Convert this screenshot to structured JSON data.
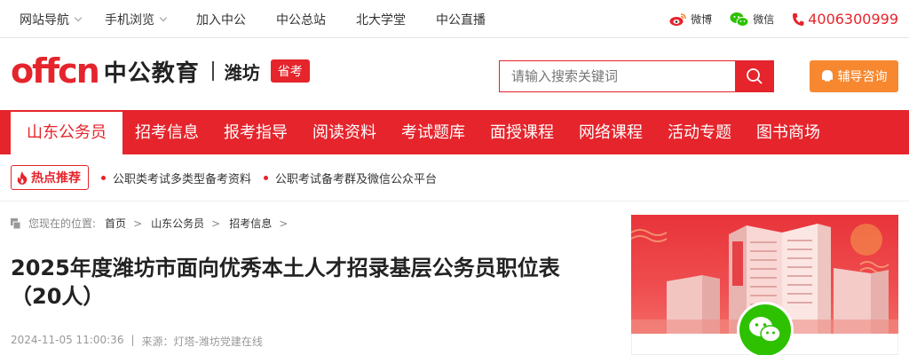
{
  "topbar": {
    "nav": [
      {
        "label": "网站导航",
        "dropdown": true
      },
      {
        "label": "手机浏览",
        "dropdown": true
      },
      {
        "label": "加入中公",
        "dropdown": false
      },
      {
        "label": "中公总站",
        "dropdown": false
      },
      {
        "label": "北大学堂",
        "dropdown": false
      },
      {
        "label": "中公直播",
        "dropdown": false
      }
    ],
    "weibo": "微博",
    "weixin": "微信",
    "phone": "4006300999"
  },
  "header": {
    "logo_latin": "offcn",
    "logo_cn": "中公教育",
    "city": "潍坊",
    "badge": "省考",
    "search_placeholder": "请输入搜索关键词",
    "consult_label": "辅导咨询"
  },
  "mainnav": {
    "items": [
      "山东公务员",
      "招考信息",
      "报考指导",
      "阅读资料",
      "考试题库",
      "面授课程",
      "网络课程",
      "活动专题",
      "图书商场"
    ],
    "active_index": 0
  },
  "hot": {
    "tag": "热点推荐",
    "links": [
      "公职类考试多类型备考资料",
      "公职考试备考群及微信公众平台"
    ]
  },
  "breadcrumb": {
    "prefix": "您现在的位置:",
    "items": [
      "首页",
      "山东公务员",
      "招考信息"
    ],
    "separator": ">"
  },
  "article": {
    "title": "2025年度潍坊市面向优秀本土人才招录基层公务员职位表（20人）",
    "date": "2024-11-05 11:00:36",
    "source": "来源：灯塔-潍坊党建在线"
  },
  "colors": {
    "brand_red": "#e5242c",
    "consult_orange": "#f7882f",
    "wechat_green": "#2dc100"
  },
  "icons": [
    "weibo-icon",
    "wechat-icon",
    "phone-icon",
    "search-icon",
    "chat-bubble-icon",
    "flame-icon",
    "home-icon"
  ]
}
